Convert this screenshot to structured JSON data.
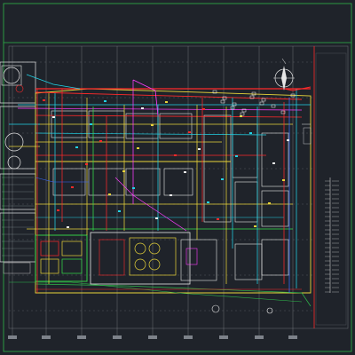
{
  "drawing": {
    "background": "#1f232a",
    "colors": {
      "frame": "#2fb84a",
      "grid": "#8a8f97",
      "outline": "#e6e6e6",
      "pipe_cyan": "#22d3e6",
      "pipe_yellow": "#e8d43a",
      "pipe_red": "#ff2a2a",
      "pipe_magenta": "#ff3cff",
      "pipe_green": "#36e04a",
      "pipe_blue": "#3a6bff",
      "text_white": "#f2f2f2",
      "title_block": "#c8c8c8"
    },
    "icons": [
      "north-arrow-icon",
      "pump-symbol-icon",
      "tank-symbol-icon"
    ]
  }
}
